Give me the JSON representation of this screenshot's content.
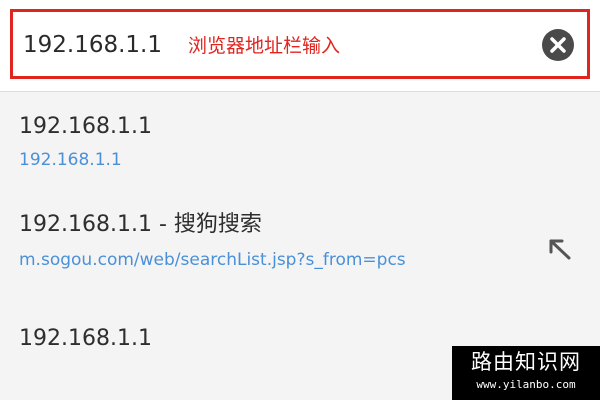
{
  "address_bar": {
    "value": "192.168.1.1",
    "annotation": "浏览器地址栏输入"
  },
  "suggestions": [
    {
      "title": "192.168.1.1",
      "url": "192.168.1.1"
    },
    {
      "title": "192.168.1.1 - 搜狗搜索",
      "url": "m.sogou.com/web/searchList.jsp?s_from=pcs"
    },
    {
      "title": "192.168.1.1"
    }
  ],
  "watermark": {
    "main": "路由知识网",
    "sub": "www.yilanbo.com"
  },
  "colors": {
    "annotation_border": "#e0251f",
    "link": "#4a90d9",
    "clear_button": "#4a4a4a",
    "background": "#f4f4f4"
  },
  "icons": {
    "clear": "close-circle-icon",
    "fill_suggestion": "arrow-up-left-icon"
  }
}
